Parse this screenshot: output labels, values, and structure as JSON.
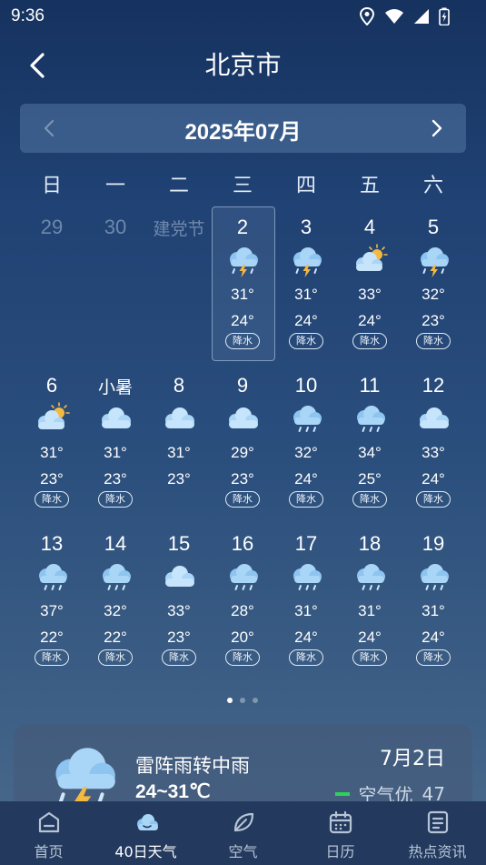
{
  "status_bar": {
    "time": "9:36"
  },
  "header": {
    "title": "北京市"
  },
  "month": {
    "label": "2025年07月"
  },
  "weekdays": [
    "日",
    "一",
    "二",
    "三",
    "四",
    "五",
    "六"
  ],
  "calendar": [
    {
      "day": "29",
      "muted": true
    },
    {
      "day": "30",
      "muted": true
    },
    {
      "day": "建党节",
      "muted": true,
      "label": true
    },
    {
      "day": "2",
      "icon": "thunder-rain",
      "hi": "31°",
      "lo": "24°",
      "rain": "降水",
      "selected": true
    },
    {
      "day": "3",
      "icon": "thunder-rain",
      "hi": "31°",
      "lo": "24°",
      "rain": "降水"
    },
    {
      "day": "4",
      "icon": "partly-cloudy",
      "hi": "33°",
      "lo": "24°",
      "rain": "降水"
    },
    {
      "day": "5",
      "icon": "thunder-rain",
      "hi": "32°",
      "lo": "23°",
      "rain": "降水"
    },
    {
      "day": "6",
      "icon": "partly-cloudy",
      "hi": "31°",
      "lo": "23°",
      "rain": "降水"
    },
    {
      "day": "小暑",
      "icon": "cloudy",
      "hi": "31°",
      "lo": "23°",
      "rain": "降水",
      "label": true
    },
    {
      "day": "8",
      "icon": "cloudy",
      "hi": "31°",
      "lo": "23°"
    },
    {
      "day": "9",
      "icon": "cloudy",
      "hi": "29°",
      "lo": "23°",
      "rain": "降水"
    },
    {
      "day": "10",
      "icon": "rain",
      "hi": "32°",
      "lo": "24°",
      "rain": "降水"
    },
    {
      "day": "11",
      "icon": "rain",
      "hi": "34°",
      "lo": "25°",
      "rain": "降水"
    },
    {
      "day": "12",
      "icon": "cloudy",
      "hi": "33°",
      "lo": "24°",
      "rain": "降水"
    },
    {
      "day": "13",
      "icon": "rain",
      "hi": "37°",
      "lo": "22°",
      "rain": "降水"
    },
    {
      "day": "14",
      "icon": "rain",
      "hi": "32°",
      "lo": "22°",
      "rain": "降水"
    },
    {
      "day": "15",
      "icon": "cloudy",
      "hi": "33°",
      "lo": "23°",
      "rain": "降水"
    },
    {
      "day": "16",
      "icon": "rain",
      "hi": "28°",
      "lo": "20°",
      "rain": "降水"
    },
    {
      "day": "17",
      "icon": "rain",
      "hi": "31°",
      "lo": "24°",
      "rain": "降水"
    },
    {
      "day": "18",
      "icon": "rain",
      "hi": "31°",
      "lo": "24°",
      "rain": "降水"
    },
    {
      "day": "19",
      "icon": "rain",
      "hi": "31°",
      "lo": "24°",
      "rain": "降水"
    }
  ],
  "detail": {
    "weather": "雷阵雨转中雨",
    "temp": "24~31℃",
    "date": "7月2日",
    "aqi_label": "空气优",
    "aqi_value": "47",
    "aqi_color": "#2ed15a",
    "icon": "thunder-rain"
  },
  "pager": {
    "count": 3,
    "active": 0
  },
  "tabs": [
    {
      "label": "首页",
      "icon": "home-icon"
    },
    {
      "label": "40日天气",
      "icon": "cloud-icon",
      "active": true
    },
    {
      "label": "空气",
      "icon": "leaf-icon"
    },
    {
      "label": "日历",
      "icon": "calendar-icon"
    },
    {
      "label": "热点资讯",
      "icon": "news-icon"
    }
  ]
}
